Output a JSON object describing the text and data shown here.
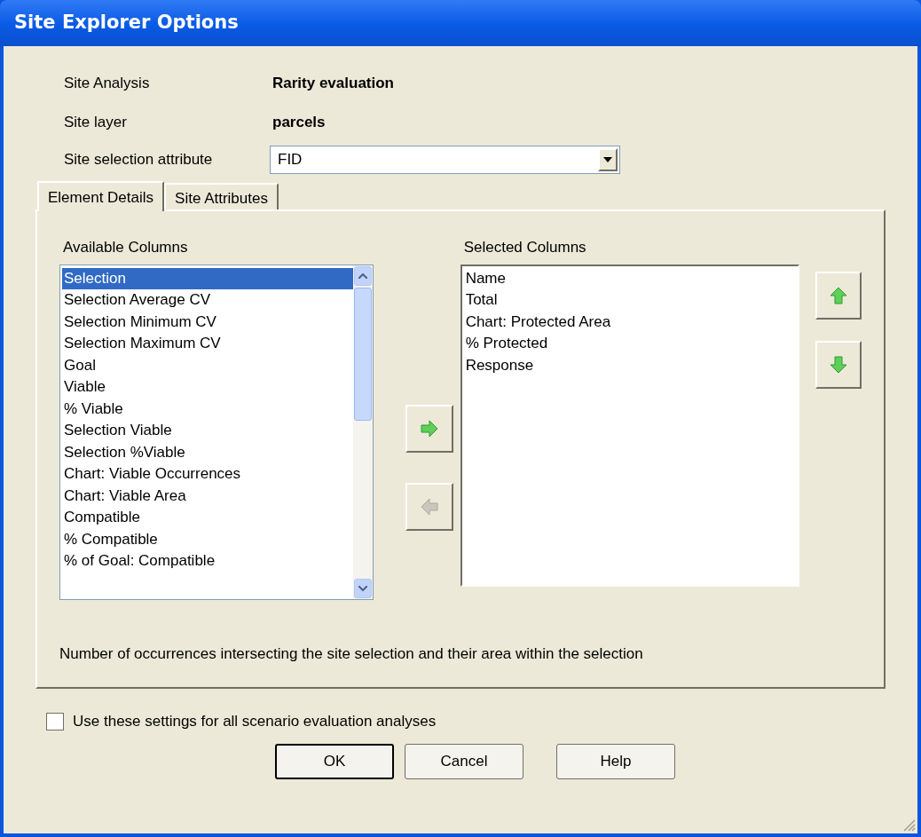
{
  "window": {
    "title": "Site Explorer Options"
  },
  "info": [
    {
      "label": "Site Analysis",
      "value": "Rarity evaluation"
    },
    {
      "label": "Site layer",
      "value": "parcels"
    }
  ],
  "attribute": {
    "label": "Site selection attribute",
    "value": "FID"
  },
  "tabs": [
    {
      "label": "Element Details",
      "selected": true
    },
    {
      "label": "Site Attributes",
      "selected": false
    }
  ],
  "available": {
    "label": "Available Columns",
    "items": [
      {
        "text": "Selection",
        "selected": true
      },
      {
        "text": "Selection Average CV",
        "selected": false
      },
      {
        "text": "Selection Minimum CV",
        "selected": false
      },
      {
        "text": "Selection Maximum CV",
        "selected": false
      },
      {
        "text": "Goal",
        "selected": false
      },
      {
        "text": "Viable",
        "selected": false
      },
      {
        "text": "% Viable",
        "selected": false
      },
      {
        "text": "Selection Viable",
        "selected": false
      },
      {
        "text": "Selection %Viable",
        "selected": false
      },
      {
        "text": "Chart: Viable Occurrences",
        "selected": false
      },
      {
        "text": "Chart: Viable Area",
        "selected": false
      },
      {
        "text": "Compatible",
        "selected": false
      },
      {
        "text": "% Compatible",
        "selected": false
      },
      {
        "text": "% of Goal: Compatible",
        "selected": false
      }
    ]
  },
  "move_buttons": [
    {
      "kind": "right",
      "disabled": false
    },
    {
      "kind": "left",
      "disabled": true
    }
  ],
  "selected": {
    "label": "Selected Columns",
    "items": [
      "Name",
      "Total",
      "Chart: Protected Area",
      "% Protected",
      "Response"
    ]
  },
  "order_buttons": [
    {
      "kind": "up",
      "disabled": false
    },
    {
      "kind": "down",
      "disabled": false
    }
  ],
  "description": "Number of occurrences intersecting the site selection and their area within the selection",
  "use_for_all": {
    "label": "Use these settings for all scenario evaluation analyses",
    "checked": false
  },
  "buttons": [
    {
      "label": "OK",
      "default": true
    },
    {
      "label": "Cancel",
      "default": false
    },
    {
      "label": "Help",
      "default": false
    }
  ]
}
